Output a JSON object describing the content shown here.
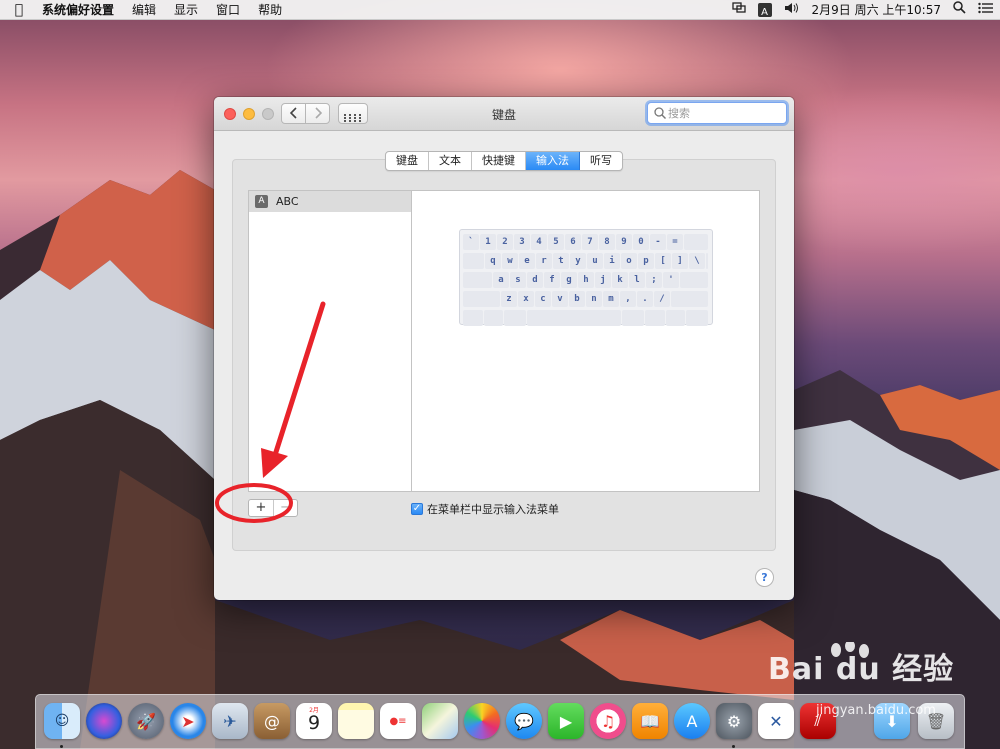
{
  "menubar": {
    "app_name": "系统偏好设置",
    "items": [
      "编辑",
      "显示",
      "窗口",
      "帮助"
    ],
    "input_indicator": "A",
    "clock": "2月9日 周六 上午10:57"
  },
  "window": {
    "title": "键盘",
    "search_placeholder": "搜索",
    "tabs": [
      "键盘",
      "文本",
      "快捷键",
      "输入法",
      "听写"
    ],
    "active_tab": "输入法",
    "input_sources": [
      {
        "label": "ABC",
        "icon_letter": "A",
        "selected": true
      }
    ],
    "keyboard_rows": [
      [
        "`",
        "1",
        "2",
        "3",
        "4",
        "5",
        "6",
        "7",
        "8",
        "9",
        "0",
        "-",
        "="
      ],
      [
        "q",
        "w",
        "e",
        "r",
        "t",
        "y",
        "u",
        "i",
        "o",
        "p",
        "[",
        "]",
        "\\"
      ],
      [
        "a",
        "s",
        "d",
        "f",
        "g",
        "h",
        "j",
        "k",
        "l",
        ";",
        "'"
      ],
      [
        "z",
        "x",
        "c",
        "v",
        "b",
        "n",
        "m",
        ",",
        ".",
        "/"
      ]
    ],
    "add_button": "+",
    "remove_button": "−",
    "show_menu_checkbox": {
      "label": "在菜单栏中显示输入法菜单",
      "checked": true
    },
    "help_button": "?"
  },
  "dock": {
    "calendar_month": "2月",
    "calendar_day": "9",
    "apps": [
      "finder",
      "siri",
      "launchpad",
      "safari",
      "mail",
      "contacts",
      "calendar",
      "notes",
      "reminders",
      "maps",
      "photos",
      "messages",
      "facetime",
      "itunes",
      "ibooks",
      "app-store",
      "system-preferences",
      "xmind",
      "parallels",
      "downloads",
      "trash"
    ]
  },
  "watermark": {
    "logo": "Bai du 经验",
    "url": "jingyan.baidu.com"
  },
  "colors": {
    "accent": "#2a8af5",
    "annotation_red": "#e8232a"
  }
}
